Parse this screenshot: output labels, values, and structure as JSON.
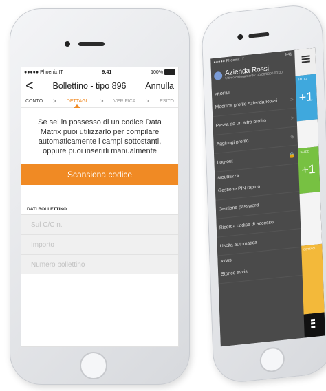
{
  "left": {
    "status": {
      "carrier": "●●●●● Phoenix IT",
      "time": "9:41",
      "battery": "100%"
    },
    "nav": {
      "back": "<",
      "title": "Bollettino - tipo 896",
      "cancel": "Annulla"
    },
    "steps": [
      "CONTO",
      "DETTAGLI",
      "VERIFICA",
      "ESITO"
    ],
    "info": "Se sei in possesso di un codice Data Matrix puoi utilizzarlo per compilare automaticamente i campi sottostanti, oppure puoi inserirli manualmente",
    "scan_button": "Scansiona codice",
    "section": "DATI BOLLETTINO",
    "fields": [
      "Sul C/C n.",
      "Importo",
      "Numero bollettino"
    ]
  },
  "right": {
    "status": {
      "carrier": "●●●●● Phoenix IT",
      "time": "9:41",
      "battery": "100%"
    },
    "account": {
      "name": "Azienda Rossi",
      "sub": "Ultimo collegamento: 00/00/0000 00:00"
    },
    "profili_header": "PROFILI",
    "profili": [
      "Modifica profilo Azienda Rossi",
      "Passa ad un altro profilo",
      "Aggiungi profilo",
      "Log-out"
    ],
    "sicurezza_header": "SICUREZZA",
    "sicurezza": [
      "Gestione PIN rapido",
      "Gestione password",
      "Ricorda codice di accesso",
      "Uscita automatica"
    ],
    "avvisi_header": "AVVISI",
    "avvisi": [
      "Storico avvisi"
    ],
    "strip": {
      "saldo1": "SALDO",
      "plus1": "+1",
      "saldo2": "SALDO",
      "plus2": "+1",
      "dettagli": "DETTAGL"
    }
  },
  "colors": {
    "accent": "#f08a24",
    "blue": "#3fa8dd",
    "green": "#77c142",
    "yellow": "#f3b93a",
    "drawer": "#4a4a4a"
  }
}
